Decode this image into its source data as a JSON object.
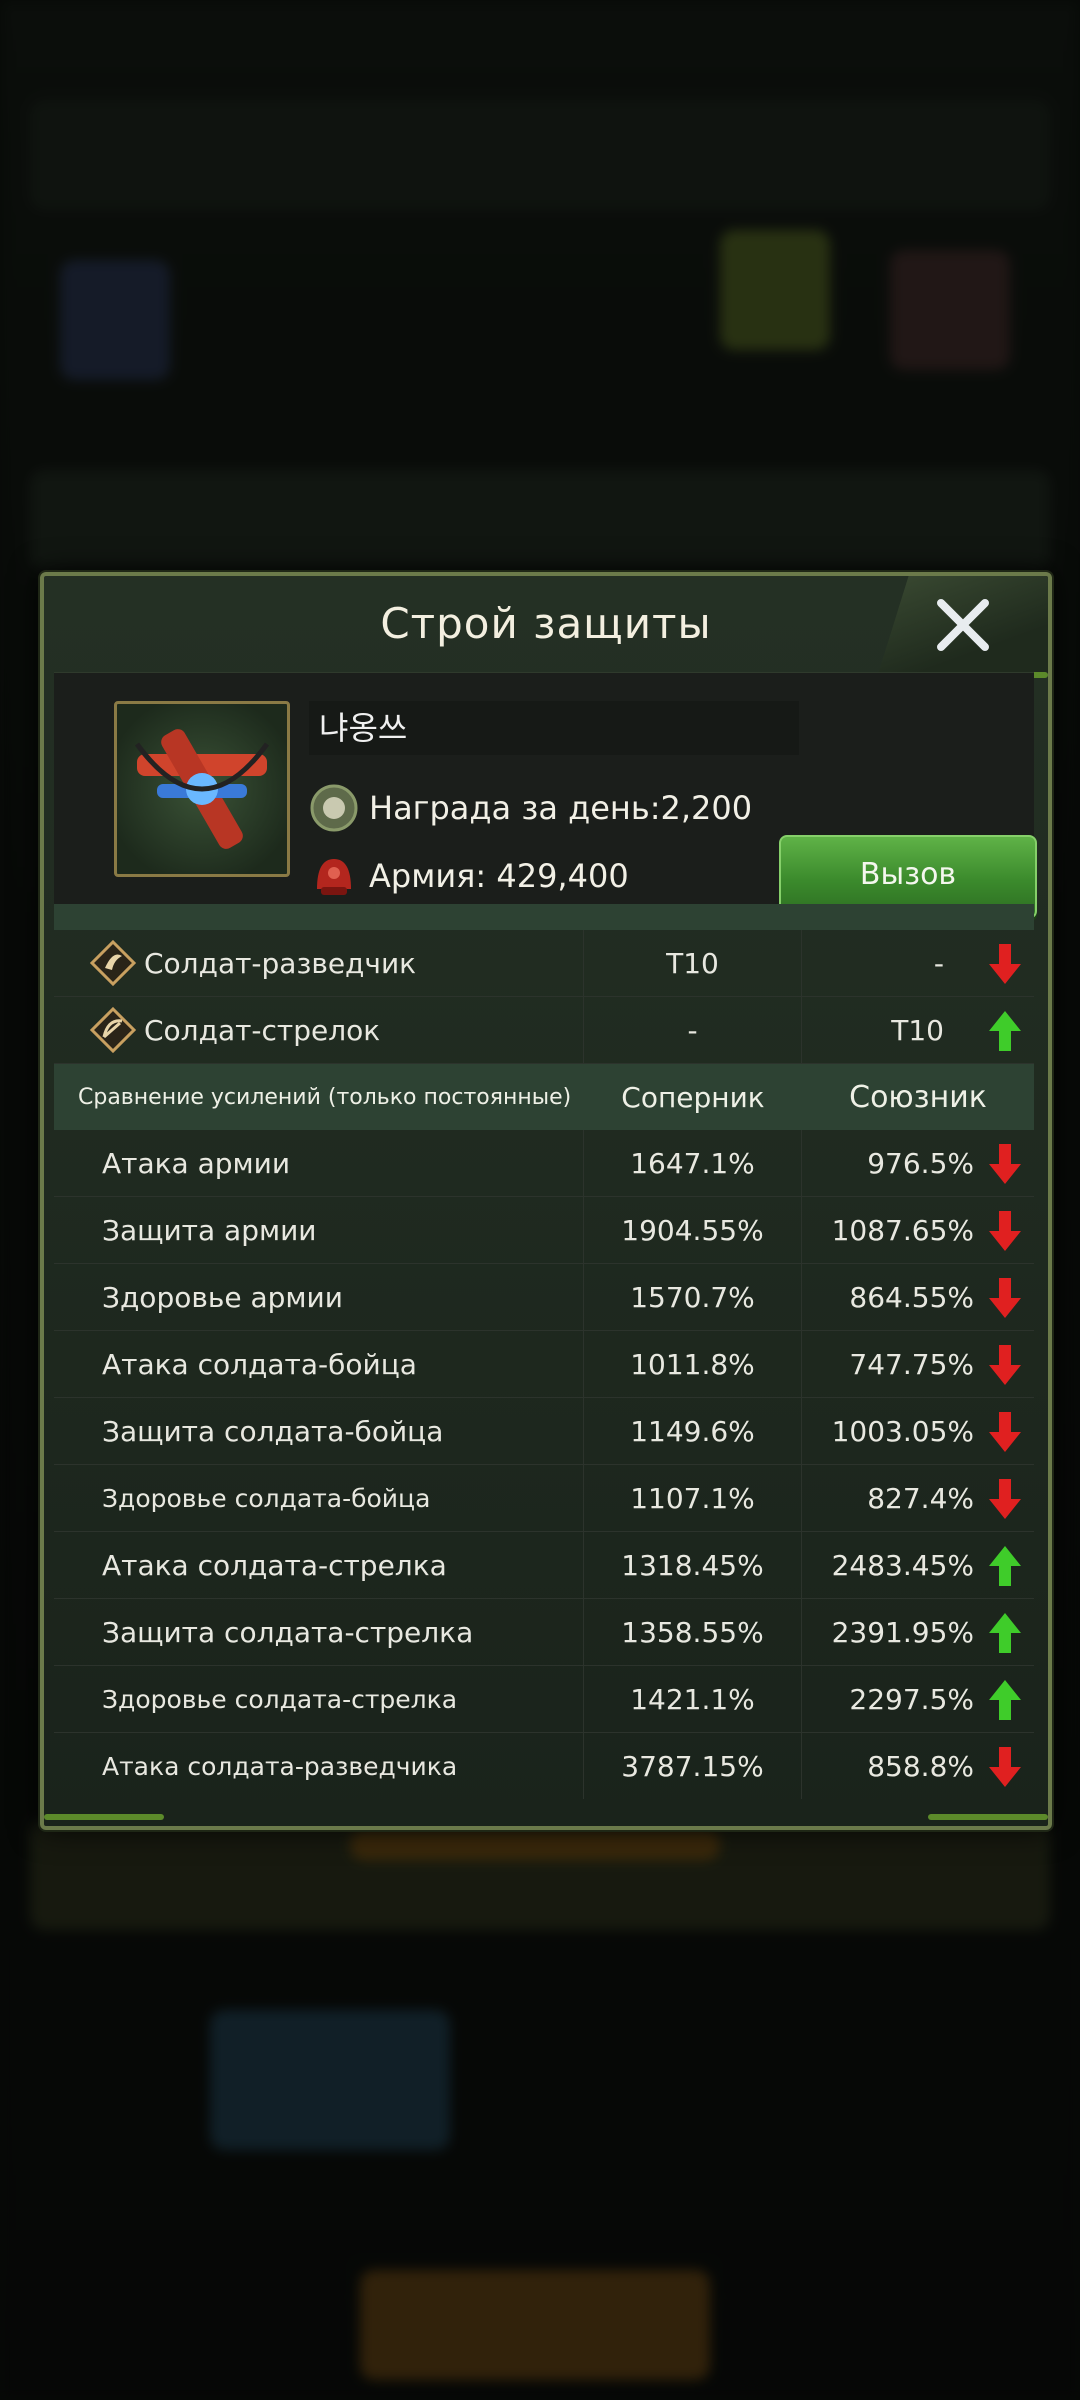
{
  "dialog": {
    "title": "Строй защиты",
    "player_name": "냐옹쓰",
    "reward_text": "Награда за день:2,200",
    "army_text": "Армия: 429,400",
    "challenge_label": "Вызов"
  },
  "tier_table": {
    "rows": [
      {
        "label": "Солдат-разведчик",
        "rival": "T10",
        "ally": "-",
        "trend": "down"
      },
      {
        "label": "Солдат-стрелок",
        "rival": "-",
        "ally": "T10",
        "trend": "up"
      }
    ]
  },
  "boost_table": {
    "header": {
      "label": "Сравнение усилений (только постоянные)",
      "rival": "Соперник",
      "ally": "Союзник"
    },
    "rows": [
      {
        "label": "Атака армии",
        "rival": "1647.1%",
        "ally": "976.5%",
        "trend": "down"
      },
      {
        "label": "Защита армии",
        "rival": "1904.55%",
        "ally": "1087.65%",
        "trend": "down"
      },
      {
        "label": "Здоровье армии",
        "rival": "1570.7%",
        "ally": "864.55%",
        "trend": "down"
      },
      {
        "label": "Атака солдата-бойца",
        "rival": "1011.8%",
        "ally": "747.75%",
        "trend": "down"
      },
      {
        "label": "Защита солдата-бойца",
        "rival": "1149.6%",
        "ally": "1003.05%",
        "trend": "down"
      },
      {
        "label": "Здоровье солдата-бойца",
        "rival": "1107.1%",
        "ally": "827.4%",
        "trend": "down"
      },
      {
        "label": "Атака солдата-стрелка",
        "rival": "1318.45%",
        "ally": "2483.45%",
        "trend": "up"
      },
      {
        "label": "Защита солдата-стрелка",
        "rival": "1358.55%",
        "ally": "2391.95%",
        "trend": "up"
      },
      {
        "label": "Здоровье солдата-стрелка",
        "rival": "1421.1%",
        "ally": "2297.5%",
        "trend": "up"
      },
      {
        "label": "Атака солдата-разведчика",
        "rival": "3787.15%",
        "ally": "858.8%",
        "trend": "down"
      }
    ]
  },
  "colors": {
    "up": "#3fcc2a",
    "down": "#e02020",
    "accent_green": "#4a9e38"
  }
}
